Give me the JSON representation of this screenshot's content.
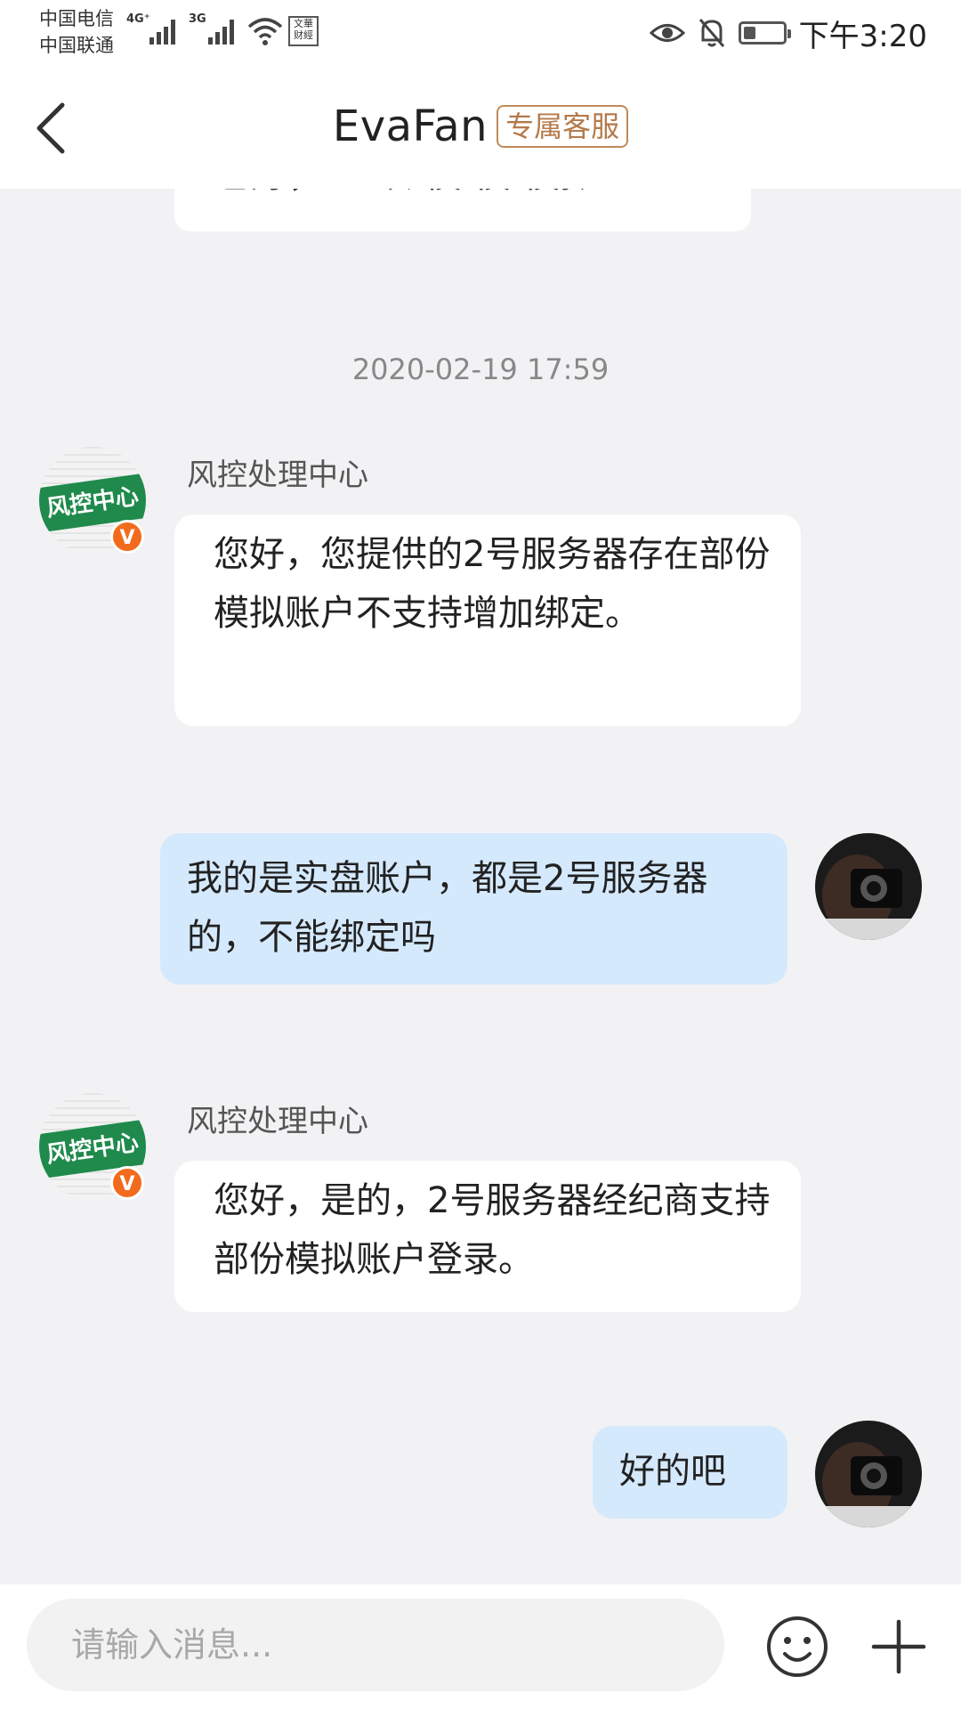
{
  "status_bar": {
    "carrier1": "中国电信",
    "carrier2": "中国联通",
    "network1": "4G⁺",
    "network2": "3G",
    "hd_tag": "文華 财經",
    "time": "下午3:20",
    "battery_level": 0.3
  },
  "header": {
    "title": "EvaFan",
    "badge": "专属客服"
  },
  "chat": {
    "partial_message": "也好，区 以 模 模 模拟…",
    "timestamp": "2020-02-19 17:59",
    "messages": [
      {
        "side": "in",
        "sender": "风控处理中心",
        "avatar_text": "风控中心",
        "badge": "V",
        "text": "您好，您提供的2号服务器存在部份模拟账户不支持增加绑定。"
      },
      {
        "side": "out",
        "text": "我的是实盘账户，都是2号服务器的，不能绑定吗"
      },
      {
        "side": "in",
        "sender": "风控处理中心",
        "avatar_text": "风控中心",
        "badge": "V",
        "text": "您好，是的，2号服务器经纪商支持部份模拟账户登录。"
      },
      {
        "side": "out",
        "text": "好的吧"
      }
    ]
  },
  "input_bar": {
    "placeholder": "请输入消息...",
    "emoji_icon": "smiley-icon",
    "plus_icon": "plus-icon"
  },
  "colors": {
    "page_bg": "#f2f2f4",
    "incoming_bubble": "#ffffff",
    "outgoing_bubble": "#d5e9fc",
    "badge_color": "#b47a4a",
    "avatar_green": "#1f8a4c",
    "verified_orange": "#f26b1d"
  }
}
